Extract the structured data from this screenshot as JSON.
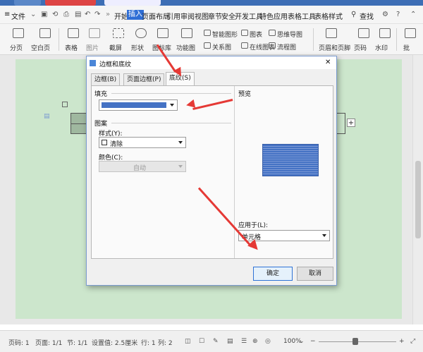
{
  "window": {
    "minimize": "—",
    "maximize": "❐",
    "close": "✕"
  },
  "menubar": {
    "hamburger": "≡",
    "file_label": "文件",
    "items": [
      "开始",
      "插入",
      "页面布局",
      "引用",
      "审阅",
      "视图",
      "章节",
      "安全",
      "开发工具",
      "特色应用",
      "表格工具",
      "表格样式"
    ],
    "active_index": 1,
    "search_label": "查找"
  },
  "ribbon": {
    "buttons": [
      "分页",
      "空白页",
      "表格",
      "图片",
      "截屏",
      "形状",
      "图标库",
      "功能图",
      "智能图形",
      "图表",
      "思维导图",
      "关系图",
      "在线图表",
      "流程图",
      "页眉和页脚",
      "页码",
      "水印",
      "批"
    ]
  },
  "dialog": {
    "title": "边框和底纹",
    "tabs": [
      "边框(B)",
      "页面边框(P)",
      "底纹(S)"
    ],
    "selected_tab": 2,
    "fill_label": "填充",
    "fill_color": "#4472c4",
    "pattern_label": "图案",
    "style_label": "样式(Y):",
    "style_value": "清除",
    "color_label": "颜色(C):",
    "color_value": "自动",
    "preview_label": "预览",
    "apply_label": "应用于(L):",
    "apply_value": "单元格",
    "ok_label": "确定",
    "cancel_label": "取消",
    "close": "✕"
  },
  "status": {
    "page": "页码: 1",
    "pages": "页面: 1/1",
    "section": "节: 1/1",
    "setting": "设置值: 2.5厘米",
    "row": "行: 1",
    "col": "列: 2",
    "zoom": "100%",
    "zoom_minus": "−",
    "zoom_plus": "+"
  },
  "colors": {
    "accent": "#2f6ed5",
    "page_bg": "#cce6cc",
    "arrow": "#e53935"
  }
}
